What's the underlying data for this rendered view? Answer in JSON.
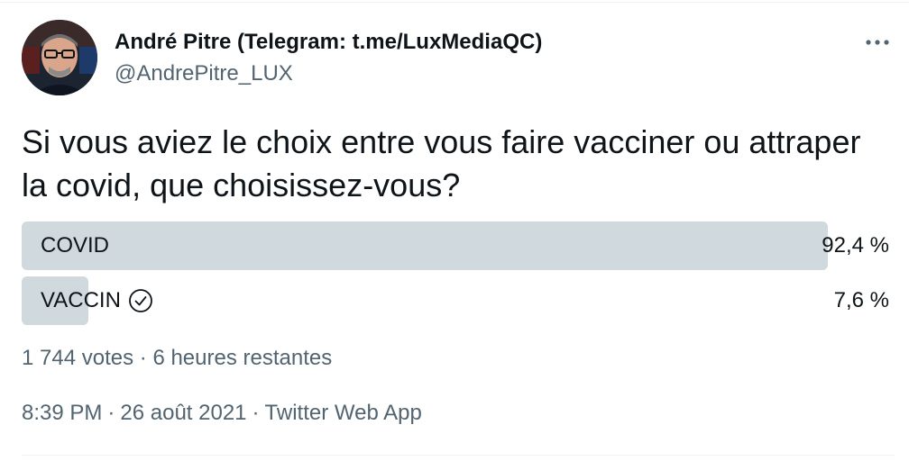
{
  "author": {
    "name": "André Pitre (Telegram: t.me/LuxMediaQC)",
    "handle": "@AndrePitre_LUX",
    "avatar_icon": "user-avatar"
  },
  "more_icon": "more-horizontal-icon",
  "tweet": {
    "text": "Si vous aviez le choix entre vous faire vacciner ou attraper la covid, que choisissez-vous?"
  },
  "poll": {
    "options": [
      {
        "label": "COVID",
        "percent_text": "92,4 %",
        "percent": 92.4,
        "selected": false
      },
      {
        "label": "VACCIN",
        "percent_text": "7,6 %",
        "percent": 7.6,
        "selected": true,
        "check_icon": "check-circle-icon"
      }
    ],
    "votes": "1 744 votes",
    "separator": "·",
    "remaining": "6 heures restantes"
  },
  "meta": {
    "time": "8:39 PM",
    "separator": "·",
    "date": "26 août 2021",
    "source": "Twitter Web App"
  },
  "colors": {
    "text_primary": "#0f1419",
    "text_secondary": "#536471",
    "poll_fill": "#cfd9de"
  }
}
